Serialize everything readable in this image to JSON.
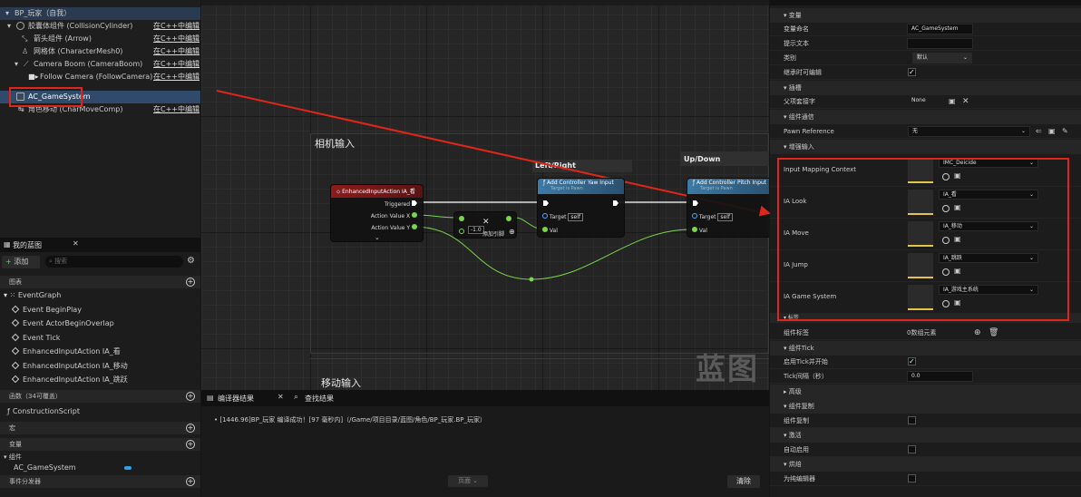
{
  "components": {
    "root": "BP_玩家（自我）",
    "items": [
      {
        "name": "胶囊体组件 (CollisionCylinder)",
        "link": "在C++中编辑"
      },
      {
        "name": "箭头组件 (Arrow)",
        "link": "在C++中编辑"
      },
      {
        "name": "网格体 (CharacterMesh0)",
        "link": "在C++中编辑"
      },
      {
        "name": "Camera Boom (CameraBoom)",
        "link": "在C++中编辑"
      },
      {
        "name": "Follow Camera (FollowCamera)",
        "link": "在C++中编辑"
      },
      {
        "name": "AC_GameSystem",
        "link": ""
      },
      {
        "name": "角色移动 (CharMoveComp)",
        "link": "在C++中编辑"
      }
    ]
  },
  "mybp": {
    "tab": "我的蓝图",
    "add": "添加",
    "search_placeholder": "搜索",
    "graphs_header": "图表",
    "event_graph": "EventGraph",
    "events": [
      "Event BeginPlay",
      "Event ActorBeginOverlap",
      "Event Tick",
      "EnhancedInputAction IA_看",
      "EnhancedInputAction IA_移动",
      "EnhancedInputAction IA_跳跃"
    ],
    "functions_header": "函数（34可覆盖）",
    "construction": "ConstructionScript",
    "macros_header": "宏",
    "variables_header": "变量",
    "components_sub": "组件",
    "var_item": "AC_GameSystem",
    "dispatchers_header": "事件分发器"
  },
  "graph": {
    "camera_comment": "相机输入",
    "move_comment": "移动输入",
    "leftright": "Left/Right",
    "updown": "Up/Down",
    "watermark": "蓝图",
    "ia_node": {
      "title": "EnhancedInputAction IA_看",
      "triggered": "Triggered",
      "avx": "Action Value X",
      "avy": "Action Value Y"
    },
    "mult_node": {
      "value": "-1.0",
      "add_pin": "添加引脚"
    },
    "yaw_node": {
      "title": "Add Controller Yaw Input",
      "sub": "Target is Pawn",
      "target": "Target",
      "self": "self",
      "val": "Val"
    },
    "pitch_node": {
      "title": "Add Controller Pitch Input",
      "sub": "Target is Pawn",
      "target": "Target",
      "self": "self",
      "val": "Val"
    }
  },
  "compiler": {
    "tab1": "编译器结果",
    "tab2": "查找结果",
    "message": "[1446.96]BP_玩家 编译成功！[97 毫秒内]（/Game/项目目录/蓝图/角色/BP_玩家.BP_玩家）",
    "page": "页面",
    "clear": "清除"
  },
  "details": {
    "variable_section": "变量",
    "var_name_label": "变量命名",
    "var_name": "AC_GameSystem",
    "tooltip_label": "提示文本",
    "category_label": "类别",
    "category": "默认",
    "inherited_label": "继承时可编辑",
    "socket_section": "插槽",
    "parent_socket_label": "父项套接字",
    "parent_socket": "None",
    "comp_comm_section": "组件通信",
    "pawn_ref_label": "Pawn Reference",
    "pawn_ref": "无",
    "enhanced_section": "增强输入",
    "mappings": [
      {
        "label": "Input Mapping Context",
        "value": "IMC_Deicide"
      },
      {
        "label": "IA Look",
        "value": "IA_看"
      },
      {
        "label": "IA Move",
        "value": "IA_移动"
      },
      {
        "label": "IA Jump",
        "value": "IA_跳跃"
      },
      {
        "label": "IA Game System",
        "value": "IA_游戏主系统"
      }
    ],
    "tags_section": "标签",
    "comp_tags_label": "组件标签",
    "comp_tags": "0数组元素",
    "tick_section": "组件Tick",
    "tick_start_label": "启用Tick并开始",
    "tick_interval_label": "Tick间隔（秒）",
    "tick_interval": "0.0",
    "advanced_section": "高级",
    "replication_section": "组件复制",
    "replicated_label": "组件复制",
    "activation_section": "激活",
    "auto_activate_label": "自动启用",
    "cooking_section": "烘焙",
    "editor_only_label": "为纯编辑器"
  }
}
